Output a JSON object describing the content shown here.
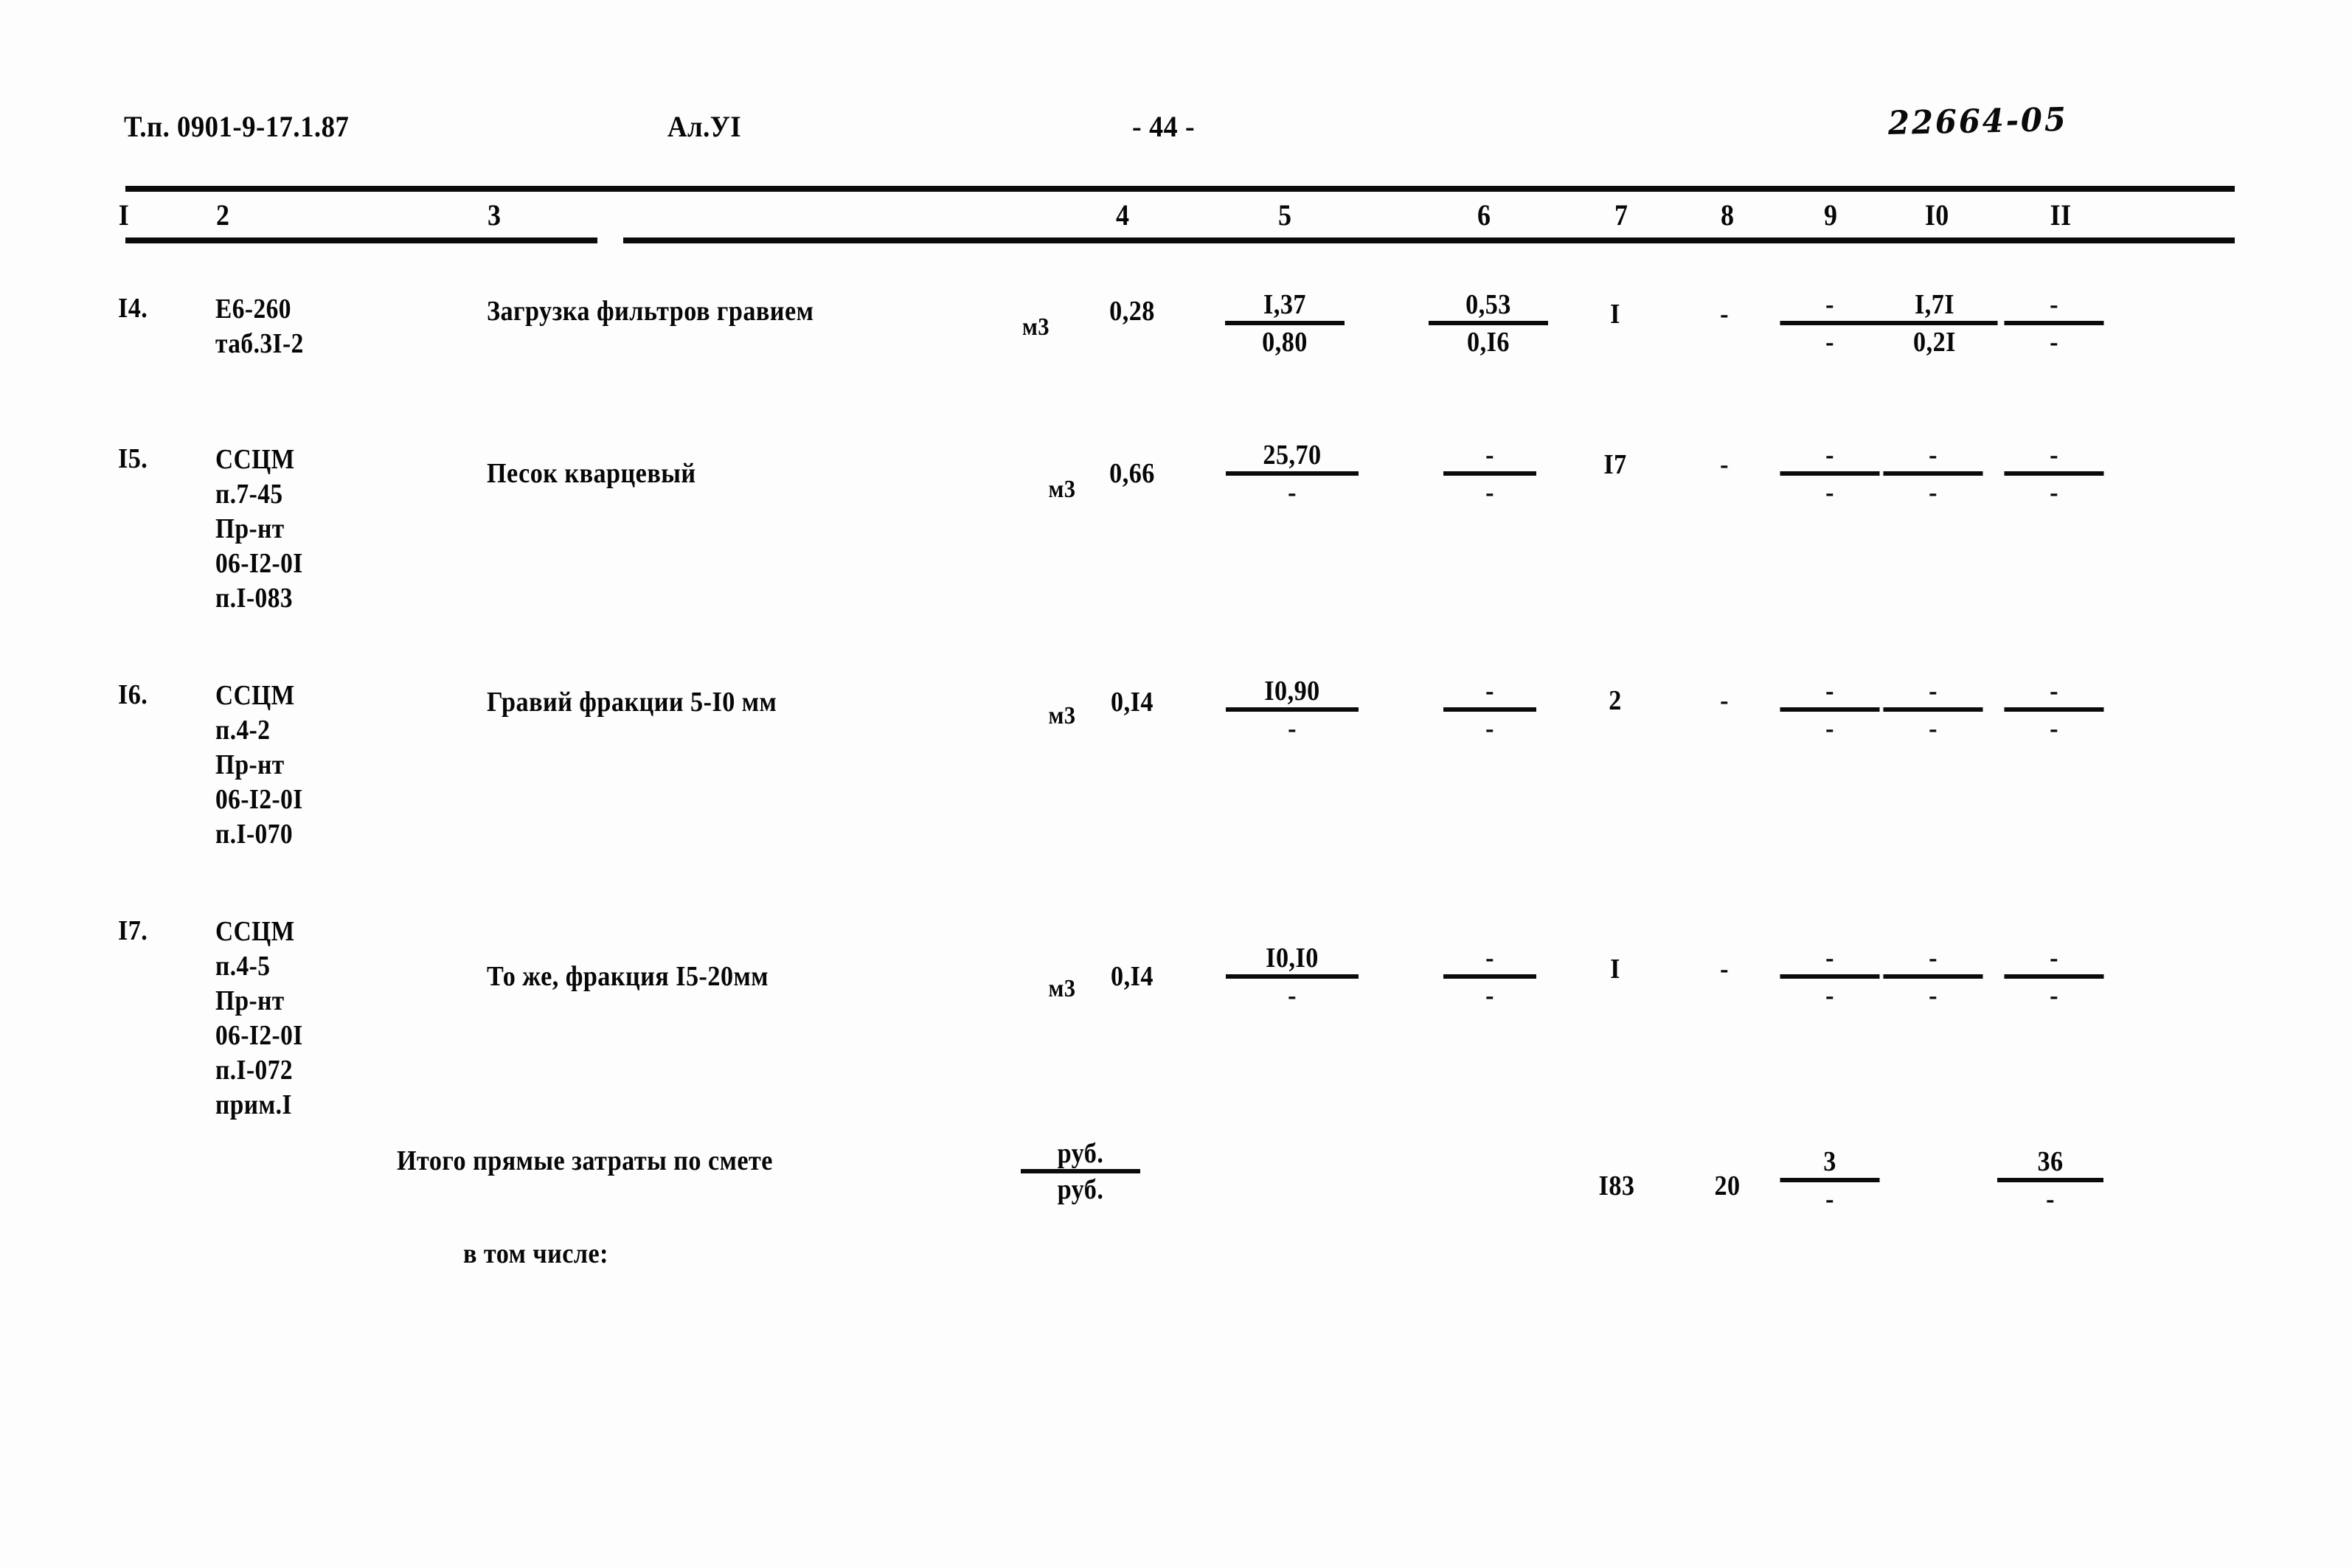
{
  "document": {
    "type_code_label": "Т.п. 0901-9-17.1.87",
    "album_label": "Ал.УI",
    "page_number_label": "- 44 -",
    "archive_stamp": "22664-05"
  },
  "table": {
    "column_numbers": [
      "I",
      "2",
      "3",
      "4",
      "5",
      "6",
      "7",
      "8",
      "9",
      "I0",
      "II"
    ],
    "rows": [
      {
        "num": "I4.",
        "code": "Е6-260\nтаб.3I-2",
        "description": "Загрузка фильтров гравием",
        "unit": "м3",
        "qty": "0,28",
        "c5_num": "I,37",
        "c5_den": "0,80",
        "c6_num": "0,53",
        "c6_den": "0,I6",
        "c7": "I",
        "c8": "-",
        "c9_num": "-",
        "c9_den": "-",
        "c10_num": "I,7I",
        "c10_den": "0,2I",
        "c11_num": "-",
        "c11_den": "-"
      },
      {
        "num": "I5.",
        "code": "ССЦМ\nп.7-45\nПр-нт\n06-I2-0I\nп.I-083",
        "description": "Песок кварцевый",
        "unit": "м3",
        "qty": "0,66",
        "c5_num": "25,70",
        "c5_den": "-",
        "c6_num": "-",
        "c6_den": "-",
        "c7": "I7",
        "c8": "-",
        "c9_num": "-",
        "c9_den": "-",
        "c10_num": "-",
        "c10_den": "-",
        "c11_num": "-",
        "c11_den": "-"
      },
      {
        "num": "I6.",
        "code": "ССЦМ\nп.4-2\nПр-нт\n06-I2-0I\nп.I-070",
        "description": "Гравий фракции 5-I0 мм",
        "unit": "м3",
        "qty": "0,I4",
        "c5_num": "I0,90",
        "c5_den": "-",
        "c6_num": "-",
        "c6_den": "-",
        "c7": "2",
        "c8": "-",
        "c9_num": "-",
        "c9_den": "-",
        "c10_num": "-",
        "c10_den": "-",
        "c11_num": "-",
        "c11_den": "-"
      },
      {
        "num": "I7.",
        "code": "ССЦМ\nп.4-5\nПр-нт\n06-I2-0I\nп.I-072\nприм.I",
        "description": "То же, фракция I5-20мм",
        "unit": "м3",
        "qty": "0,I4",
        "c5_num": "I0,I0",
        "c5_den": "-",
        "c6_num": "-",
        "c6_den": "-",
        "c7": "I",
        "c8": "-",
        "c9_num": "-",
        "c9_den": "-",
        "c10_num": "-",
        "c10_den": "-",
        "c11_num": "-",
        "c11_den": "-"
      }
    ],
    "totals": {
      "label": "Итого прямые затраты по смете",
      "unit_num": "руб.",
      "unit_den": "руб.",
      "c7": "I83",
      "c8": "20",
      "c9_num": "3",
      "c9_den": "-",
      "c10_num": "",
      "c10_den": "",
      "c11_num": "36",
      "c11_den": "-"
    },
    "including_label": "в том числе:"
  }
}
